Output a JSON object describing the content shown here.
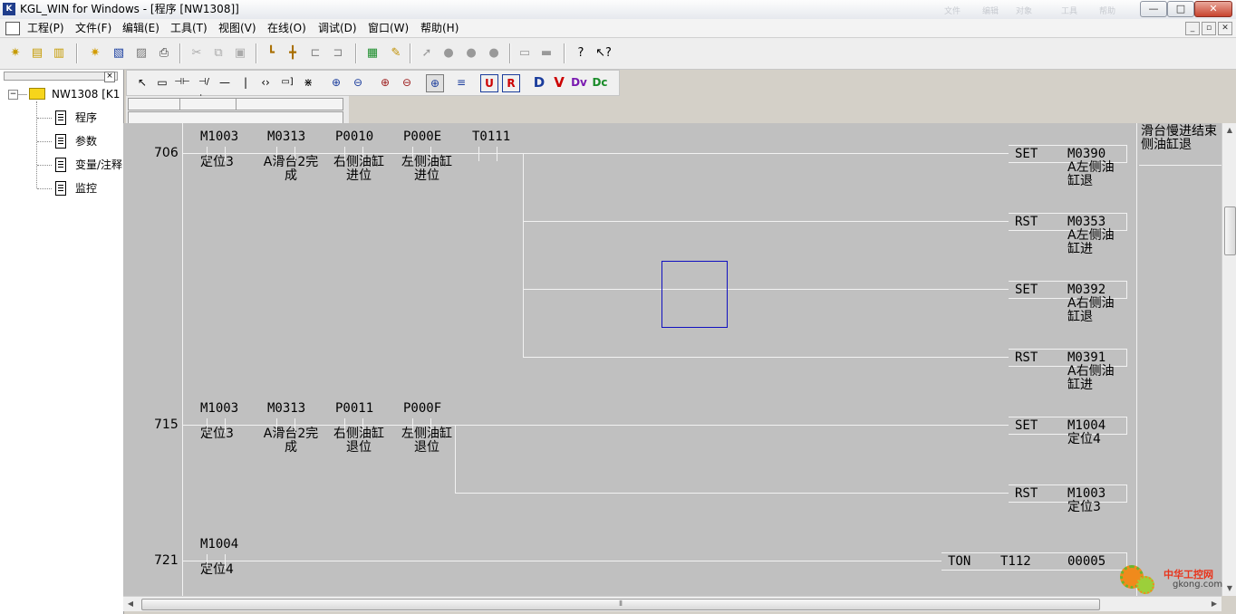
{
  "window": {
    "title": "KGL_WIN for Windows - [程序 [NW1308]]",
    "icon_text": "K",
    "faint_tabs": [
      "文件",
      "编辑",
      "对象",
      "工具",
      "帮助"
    ],
    "controls": {
      "minimize": "—",
      "maximize": "□",
      "close": "✕"
    }
  },
  "menubar": {
    "icon": "app-doc-icon",
    "items": [
      "工程(P)",
      "文件(F)",
      "编辑(E)",
      "工具(T)",
      "视图(V)",
      "在线(O)",
      "调试(D)",
      "窗口(W)",
      "帮助(H)"
    ],
    "mdi_controls": [
      "_",
      "▫",
      "✕"
    ]
  },
  "toolbar1": {
    "icons": [
      "new-project-icon",
      "open-project-icon",
      "project-tree-icon",
      "new-file-icon",
      "open-file-icon",
      "save-icon",
      "print-icon",
      "cut-icon",
      "copy-icon",
      "paste-icon",
      "monitor-icon",
      "monitor-all-icon",
      "io-icon",
      "io2-icon",
      "compile-icon",
      "download-icon",
      "run-icon",
      "stop-icon",
      "pause-icon",
      "reset-icon",
      "plc-icon",
      "plc2-icon",
      "help-icon",
      "context-help-icon"
    ]
  },
  "toolbar2": {
    "glyphs": [
      "↖",
      "▭",
      "⊣⊢",
      "⊣/⊢",
      "—",
      "|",
      "‹›",
      "▭]",
      "⋇",
      "⊕",
      "⊖",
      "⊕",
      "⊖",
      "⊕",
      "≡",
      "U",
      "R",
      "D",
      "V",
      "Dv",
      "Dc"
    ]
  },
  "tree": {
    "root": "NW1308 [K1",
    "items": [
      "程序",
      "参数",
      "变量/注释",
      "监控"
    ]
  },
  "ladder": {
    "rungs": [
      {
        "number": "706",
        "contacts": [
          {
            "address": "M1003",
            "comment": [
              "定位3"
            ]
          },
          {
            "address": "M0313",
            "comment": [
              "A滑台2完",
              "成"
            ]
          },
          {
            "address": "P0010",
            "comment": [
              "右侧油缸",
              "进位"
            ]
          },
          {
            "address": "P000E",
            "comment": [
              "左侧油缸",
              "进位"
            ]
          },
          {
            "address": "T0111",
            "comment": []
          }
        ],
        "outputs": [
          {
            "instr": "SET",
            "address": "M0390",
            "comment": [
              "A左侧油",
              "缸退"
            ]
          },
          {
            "instr": "RST",
            "address": "M0353",
            "comment": [
              "A左侧油",
              "缸进"
            ]
          },
          {
            "instr": "SET",
            "address": "M0392",
            "comment": [
              "A右侧油",
              "缸退"
            ]
          },
          {
            "instr": "RST",
            "address": "M0391",
            "comment": [
              "A右侧油",
              "缸进"
            ]
          }
        ],
        "side_comment": [
          "滑台慢进结束",
          "侧油缸退"
        ]
      },
      {
        "number": "715",
        "contacts": [
          {
            "address": "M1003",
            "comment": [
              "定位3"
            ]
          },
          {
            "address": "M0313",
            "comment": [
              "A滑台2完",
              "成"
            ]
          },
          {
            "address": "P0011",
            "comment": [
              "右侧油缸",
              "退位"
            ]
          },
          {
            "address": "P000F",
            "comment": [
              "左侧油缸",
              "退位"
            ]
          }
        ],
        "outputs": [
          {
            "instr": "SET",
            "address": "M1004",
            "comment": [
              "定位4"
            ]
          },
          {
            "instr": "RST",
            "address": "M1003",
            "comment": [
              "定位3"
            ]
          }
        ]
      },
      {
        "number": "721",
        "contacts": [
          {
            "address": "M1004",
            "comment": [
              "定位4"
            ]
          }
        ],
        "outputs": [
          {
            "instr": "TON",
            "address": "T112",
            "value": "00005"
          }
        ]
      }
    ]
  },
  "scrollbar": {
    "grip": "⦀"
  },
  "watermark": {
    "cn": "中华工控网",
    "en": "gkong.com"
  }
}
